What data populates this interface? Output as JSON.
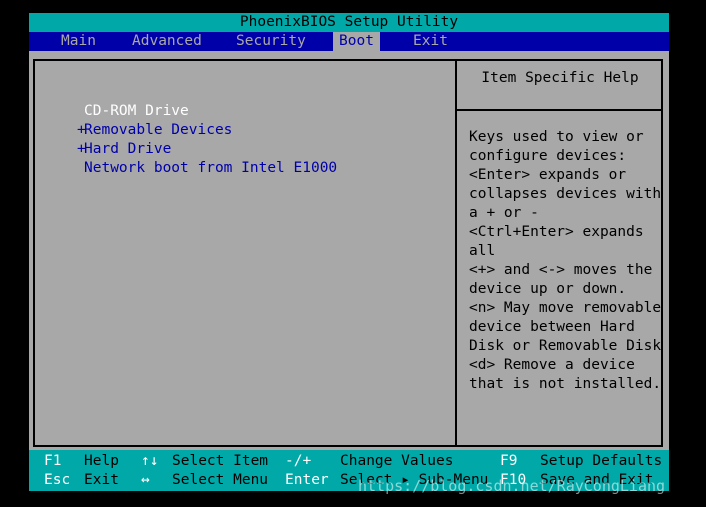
{
  "title": "PhoenixBIOS Setup Utility",
  "menu": {
    "items": [
      "Main",
      "Advanced",
      "Security",
      "Boot",
      "Exit"
    ],
    "active": "Boot"
  },
  "boot_list": [
    {
      "prefix": "",
      "label": "CD-ROM Drive",
      "selected": true
    },
    {
      "prefix": "+",
      "label": "Removable Devices",
      "selected": false
    },
    {
      "prefix": "+",
      "label": "Hard Drive",
      "selected": false
    },
    {
      "prefix": "",
      "label": "Network boot from Intel E1000",
      "selected": false
    }
  ],
  "help": {
    "title": "Item Specific Help",
    "lines": [
      "Keys used to view or",
      "configure devices:",
      "<Enter> expands or",
      "collapses devices with",
      "a + or -",
      "<Ctrl+Enter> expands",
      "all",
      "<+> and <-> moves the",
      "device up or down.",
      "<n> May move removable",
      "device between Hard",
      "Disk or Removable Disk",
      "<d> Remove a device",
      "that is not installed."
    ]
  },
  "footer": {
    "row1": [
      {
        "key": "F1",
        "desc": "Help"
      },
      {
        "key": "↑↓",
        "desc": "Select Item"
      },
      {
        "key": "-/+",
        "desc": "Change Values"
      },
      {
        "key": "F9",
        "desc": "Setup Defaults"
      }
    ],
    "row2": [
      {
        "key": "Esc",
        "desc": "Exit"
      },
      {
        "key": "↔",
        "desc": "Select Menu"
      },
      {
        "key": "Enter",
        "desc": "Select ▸ Sub-Menu"
      },
      {
        "key": "F10",
        "desc": "Save and Exit"
      }
    ]
  },
  "watermark": "https://blog.csdn.net/RayCongLiang",
  "colors": {
    "cyan": "#00a8a8",
    "blue": "#0000a8",
    "gray": "#a8a8a8",
    "white": "#ffffff"
  }
}
